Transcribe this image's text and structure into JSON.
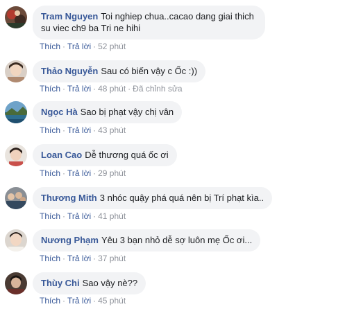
{
  "comments": [
    {
      "author": "Tram Nguyen",
      "text": "Toi nghiep chua..cacao dang giai thich su viec ch9 ba Tri ne hihi",
      "like": "Thích",
      "reply": "Trả lời",
      "time": "52 phút",
      "edited": ""
    },
    {
      "author": "Thảo Nguyễn",
      "text": "Sau có biến vậy c Ốc :))",
      "like": "Thích",
      "reply": "Trả lời",
      "time": "48 phút",
      "edited": "Đã chỉnh sửa"
    },
    {
      "author": "Ngọc Hà",
      "text": "Sao bị phạt vậy chị vân",
      "like": "Thích",
      "reply": "Trả lời",
      "time": "43 phút",
      "edited": ""
    },
    {
      "author": "Loan Cao",
      "text": "Dễ thương quá ốc ơi",
      "like": "Thích",
      "reply": "Trả lời",
      "time": "29 phút",
      "edited": ""
    },
    {
      "author": "Thương Mith",
      "text": "3 nhóc quậy phá quá nên bị Trí phạt kìa..",
      "like": "Thích",
      "reply": "Trả lời",
      "time": "41 phút",
      "edited": ""
    },
    {
      "author": "Nương Phạm",
      "text": "Yêu 3 bạn nhỏ dễ sợ luôn mẹ Ốc ơi...",
      "like": "Thích",
      "reply": "Trả lời",
      "time": "37 phút",
      "edited": ""
    },
    {
      "author": "Thùy Chi",
      "text": "Sao vậy nè??",
      "like": "Thích",
      "reply": "Trả lời",
      "time": "45 phút",
      "edited": ""
    }
  ],
  "colors": {
    "author_link": "#385898",
    "bubble_bg": "#f2f3f5",
    "meta_text": "#90949c"
  }
}
